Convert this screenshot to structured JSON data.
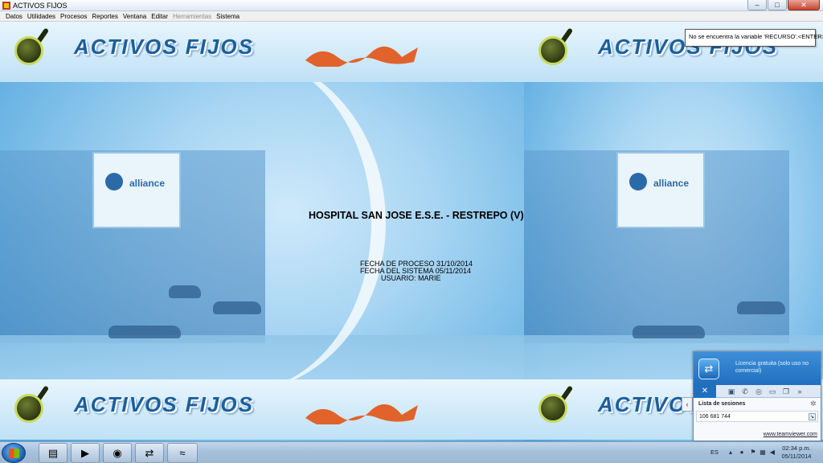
{
  "window": {
    "title": "ACTIVOS FIJOS",
    "controls": {
      "minimize": "–",
      "maximize": "□",
      "close": "✕"
    }
  },
  "menu": {
    "items": [
      {
        "label": "Datos",
        "enabled": true
      },
      {
        "label": "Utilidades",
        "enabled": true
      },
      {
        "label": "Procesos",
        "enabled": true
      },
      {
        "label": "Reportes",
        "enabled": true
      },
      {
        "label": "Ventana",
        "enabled": true
      },
      {
        "label": "Editar",
        "enabled": true
      },
      {
        "label": "Herramientas",
        "enabled": false
      },
      {
        "label": "Sistema",
        "enabled": true
      }
    ]
  },
  "banner": {
    "brand": "ACTIVOS FIJOS",
    "sign_text": "alliance"
  },
  "main": {
    "hospital": "HOSPITAL SAN JOSE E.S.E. - RESTREPO (V)",
    "process_date": "FECHA DE PROCESO 31/10/2014",
    "system_date": "FECHA DEL SISTEMA 05/11/2014",
    "user": "USUARIO: MARIE"
  },
  "message": {
    "text": "No se encuentra la variable 'RECURSO'.<ENTER>"
  },
  "teamviewer": {
    "license": "Licencia gratuita (solo uso no comercial)",
    "close_label": "✕",
    "sessions_title": "Lista de sesiones",
    "session_id": "106 681 744",
    "link": "www.teamviewer.com",
    "side_arrow": "‹"
  },
  "taskbar": {
    "language": "ES",
    "time": "02:34 p.m.",
    "date": "05/11/2014"
  },
  "colors": {
    "accent": "#1f6fbe",
    "brand_text": "#1c5f9a",
    "logo_green": "#c7d95c"
  }
}
